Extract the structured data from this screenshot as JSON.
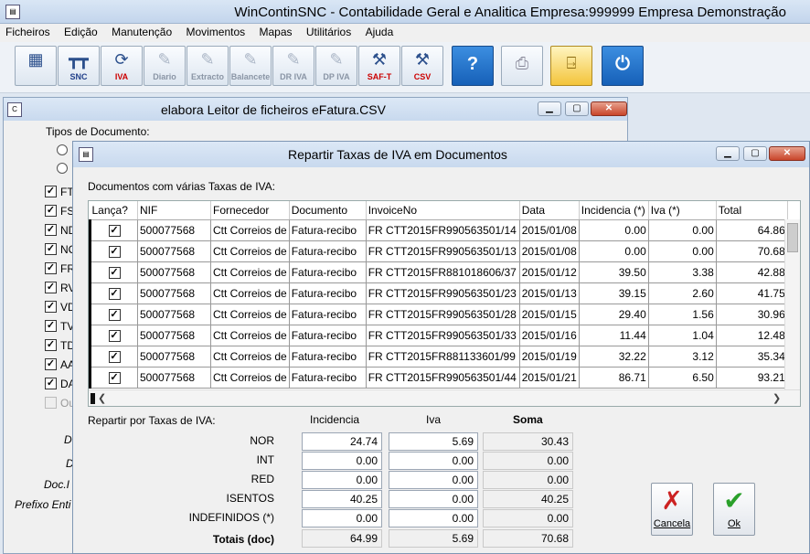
{
  "app": {
    "title": "WinContinSNC - Contabilidade Geral e Analitica Empresa:999999 Empresa Demonstração"
  },
  "menu": [
    "Ficheiros",
    "Edição",
    "Manutenção",
    "Movimentos",
    "Mapas",
    "Utilitários",
    "Ajuda"
  ],
  "toolbar": [
    {
      "label": "",
      "icon": "table-icon"
    },
    {
      "label": "SNC",
      "icon": "snc-icon"
    },
    {
      "label": "IVA",
      "icon": "iva-icon"
    },
    {
      "label": "Diario",
      "icon": "diario-icon"
    },
    {
      "label": "Extracto",
      "icon": "extracto-icon"
    },
    {
      "label": "Balancete",
      "icon": "balancete-icon"
    },
    {
      "label": "DR IVA",
      "icon": "dr-iva-icon"
    },
    {
      "label": "DP IVA",
      "icon": "dp-iva-icon"
    },
    {
      "label": "SAF-T",
      "icon": "saft-icon"
    },
    {
      "label": "CSV",
      "icon": "csv-icon"
    },
    {
      "label": "",
      "icon": "help-icon"
    },
    {
      "label": "",
      "icon": "printer-icon"
    },
    {
      "label": "",
      "icon": "exit-door-icon"
    },
    {
      "label": "",
      "icon": "power-icon"
    }
  ],
  "back_window": {
    "title": "elabora Leitor de ficheiros eFatura.CSV",
    "tipos_label": "Tipos de Documento:",
    "checkboxes": [
      "FT",
      "FS",
      "ND",
      "NC",
      "FR",
      "RV",
      "VD",
      "TV",
      "TD",
      "AA",
      "DA"
    ],
    "disabled_checkbox": "Ou",
    "side_labels": [
      "D",
      "D",
      "Doc.I",
      "Prefixo Enti"
    ]
  },
  "dialog": {
    "title": "Repartir Taxas de IVA em Documentos",
    "grid_label": "Documentos com várias Taxas de IVA:",
    "columns": [
      "Lança?",
      "NIF",
      "Fornecedor",
      "Documento",
      "InvoiceNo",
      "Data",
      "Incidencia (*)",
      "Iva (*)",
      "Total"
    ],
    "rows": [
      {
        "nif": "500077568",
        "fornecedor": "Ctt Correios de",
        "documento": "Fatura-recibo",
        "invoice": "FR CTT2015FR990563501/14",
        "data": "2015/01/08",
        "incidencia": "0.00",
        "iva": "0.00",
        "total": "64.86"
      },
      {
        "nif": "500077568",
        "fornecedor": "Ctt Correios de",
        "documento": "Fatura-recibo",
        "invoice": "FR CTT2015FR990563501/13",
        "data": "2015/01/08",
        "incidencia": "0.00",
        "iva": "0.00",
        "total": "70.68"
      },
      {
        "nif": "500077568",
        "fornecedor": "Ctt Correios de",
        "documento": "Fatura-recibo",
        "invoice": "FR CTT2015FR881018606/37",
        "data": "2015/01/12",
        "incidencia": "39.50",
        "iva": "3.38",
        "total": "42.88"
      },
      {
        "nif": "500077568",
        "fornecedor": "Ctt Correios de",
        "documento": "Fatura-recibo",
        "invoice": "FR CTT2015FR990563501/23",
        "data": "2015/01/13",
        "incidencia": "39.15",
        "iva": "2.60",
        "total": "41.75"
      },
      {
        "nif": "500077568",
        "fornecedor": "Ctt Correios de",
        "documento": "Fatura-recibo",
        "invoice": "FR CTT2015FR990563501/28",
        "data": "2015/01/15",
        "incidencia": "29.40",
        "iva": "1.56",
        "total": "30.96"
      },
      {
        "nif": "500077568",
        "fornecedor": "Ctt Correios de",
        "documento": "Fatura-recibo",
        "invoice": "FR CTT2015FR990563501/33",
        "data": "2015/01/16",
        "incidencia": "11.44",
        "iva": "1.04",
        "total": "12.48"
      },
      {
        "nif": "500077568",
        "fornecedor": "Ctt Correios de",
        "documento": "Fatura-recibo",
        "invoice": "FR CTT2015FR881133601/99",
        "data": "2015/01/19",
        "incidencia": "32.22",
        "iva": "3.12",
        "total": "35.34"
      },
      {
        "nif": "500077568",
        "fornecedor": "Ctt Correios de",
        "documento": "Fatura-recibo",
        "invoice": "FR CTT2015FR990563501/44",
        "data": "2015/01/21",
        "incidencia": "86.71",
        "iva": "6.50",
        "total": "93.21"
      }
    ],
    "split_label": "Repartir por Taxas de IVA:",
    "split_headers": {
      "incidencia": "Incidencia",
      "iva": "Iva",
      "soma": "Soma"
    },
    "split_rows": [
      {
        "label": "NOR",
        "incidencia": "24.74",
        "iva": "5.69",
        "soma": "30.43"
      },
      {
        "label": "INT",
        "incidencia": "0.00",
        "iva": "0.00",
        "soma": "0.00"
      },
      {
        "label": "RED",
        "incidencia": "0.00",
        "iva": "0.00",
        "soma": "0.00"
      },
      {
        "label": "ISENTOS",
        "incidencia": "40.25",
        "iva": "0.00",
        "soma": "40.25"
      },
      {
        "label": "INDEFINIDOS (*)",
        "incidencia": "0.00",
        "iva": "0.00",
        "soma": "0.00"
      }
    ],
    "totals": {
      "label": "Totais (doc)",
      "incidencia": "64.99",
      "iva": "5.69",
      "soma": "70.68"
    },
    "cancel_label": "Cancela",
    "ok_label": "Ok"
  }
}
